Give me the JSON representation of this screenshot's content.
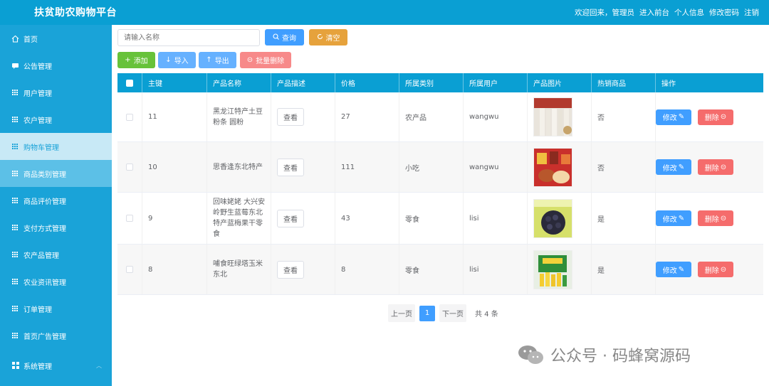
{
  "header": {
    "brand": "扶贫助农购物平台",
    "welcome": "欢迎回来，管理员",
    "links": [
      "进入前台",
      "个人信息",
      "修改密码",
      "注销"
    ]
  },
  "sidebar": {
    "items": [
      {
        "label": "首页",
        "icon": "home-icon"
      },
      {
        "label": "公告管理",
        "icon": "announcement-icon"
      },
      {
        "label": "用户管理",
        "icon": "grid-icon"
      },
      {
        "label": "农户管理",
        "icon": "grid-icon"
      },
      {
        "label": "购物车管理",
        "icon": "grid-icon"
      },
      {
        "label": "商品类别管理",
        "icon": "grid-icon"
      },
      {
        "label": "商品评价管理",
        "icon": "grid-icon"
      },
      {
        "label": "支付方式管理",
        "icon": "grid-icon"
      },
      {
        "label": "农产品管理",
        "icon": "grid-icon"
      },
      {
        "label": "农业资讯管理",
        "icon": "grid-icon"
      },
      {
        "label": "订单管理",
        "icon": "grid-icon"
      },
      {
        "label": "首页广告管理",
        "icon": "grid-icon"
      },
      {
        "label": "系统管理",
        "icon": "apps-icon"
      }
    ]
  },
  "search": {
    "placeholder": "请输入名称"
  },
  "toolbar": {
    "query": "查询",
    "clear": "清空",
    "add": "添加",
    "import": "导入",
    "export": "导出",
    "batch_delete": "批量删除"
  },
  "table": {
    "headers": [
      "主键",
      "产品名称",
      "产品描述",
      "价格",
      "所属类别",
      "所属用户",
      "产品图片",
      "热销商品",
      "操作"
    ],
    "view_label": "查看",
    "edit_label": "修改",
    "delete_label": "删除",
    "rows": [
      {
        "id": "11",
        "name": "黑龙江特产土豆粉条 圆粉",
        "price": "27",
        "category": "农产品",
        "user": "wangwu",
        "hot": "否"
      },
      {
        "id": "10",
        "name": "思香逢东北特产",
        "price": "111",
        "category": "小吃",
        "user": "wangwu",
        "hot": "否"
      },
      {
        "id": "9",
        "name": "回味姥姥 大兴安岭野生蓝莓东北特产蓝梅果干零食",
        "price": "43",
        "category": "零食",
        "user": "lisi",
        "hot": "是"
      },
      {
        "id": "8",
        "name": "哺食旺绿塔玉米东北",
        "price": "8",
        "category": "零食",
        "user": "lisi",
        "hot": "是"
      }
    ]
  },
  "pager": {
    "prev": "上一页",
    "current": "1",
    "next": "下一页",
    "total": "共 4 条"
  },
  "watermark": {
    "text": "公众号 · 码蜂窝源码"
  },
  "colors": {
    "primary": "#0a9fd3",
    "blue": "#409eff",
    "red": "#f56c6c",
    "orange": "#e6a23c",
    "green": "#67c23a"
  }
}
